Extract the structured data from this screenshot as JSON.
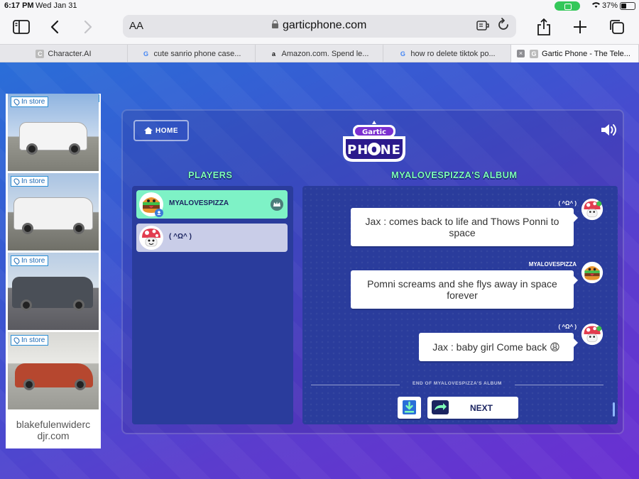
{
  "status": {
    "time": "6:17 PM",
    "date": "Wed Jan 31",
    "battery": "37%"
  },
  "browser": {
    "text_size_label": "AA",
    "url": "garticphone.com"
  },
  "tabs": [
    {
      "title": "Character.AI",
      "favicon": "C",
      "favicon_color": "#bbbbbb"
    },
    {
      "title": "cute sanrio phone case...",
      "favicon": "G",
      "favicon_color": "#4285f4"
    },
    {
      "title": "Amazon.com. Spend le...",
      "favicon": "a",
      "favicon_color": "#111111"
    },
    {
      "title": "how ro delete tiktok po...",
      "favicon": "G",
      "favicon_color": "#4285f4"
    },
    {
      "title": "Gartic Phone - The Tele...",
      "favicon": "G",
      "favicon_color": "#bbbbbb",
      "active": true
    }
  ],
  "ad": {
    "badge": "In store",
    "domain_line1": "blakefulenwiderc",
    "domain_line2": "djr.com"
  },
  "game": {
    "home_label": "HOME",
    "logo_top": "Gartic",
    "logo_bottom": "PHONE",
    "players_heading": "PLAYERS",
    "album_heading": "MYALOVESPIZZA'S ALBUM",
    "players": [
      {
        "name": "MYALOVESPIZZA",
        "host": true
      },
      {
        "name": "( ^Ω^ )",
        "host": false
      }
    ],
    "messages": [
      {
        "author": "( ^Ω^ )",
        "text": "Jax : comes back to life and Thows Ponni to space"
      },
      {
        "author": "MYALOVESPIZZA",
        "text": "Pomni screams and she flys away in space forever"
      },
      {
        "author": "( ^Ω^ )",
        "text": "Jax : baby girl Come back 😩"
      }
    ],
    "end_label": "END OF MYALOVESPIZZA'S ALBUM",
    "next_label": "NEXT"
  },
  "colors": {
    "accent_green": "#7dfcb7",
    "panel_blue": "#2a3c9c"
  }
}
